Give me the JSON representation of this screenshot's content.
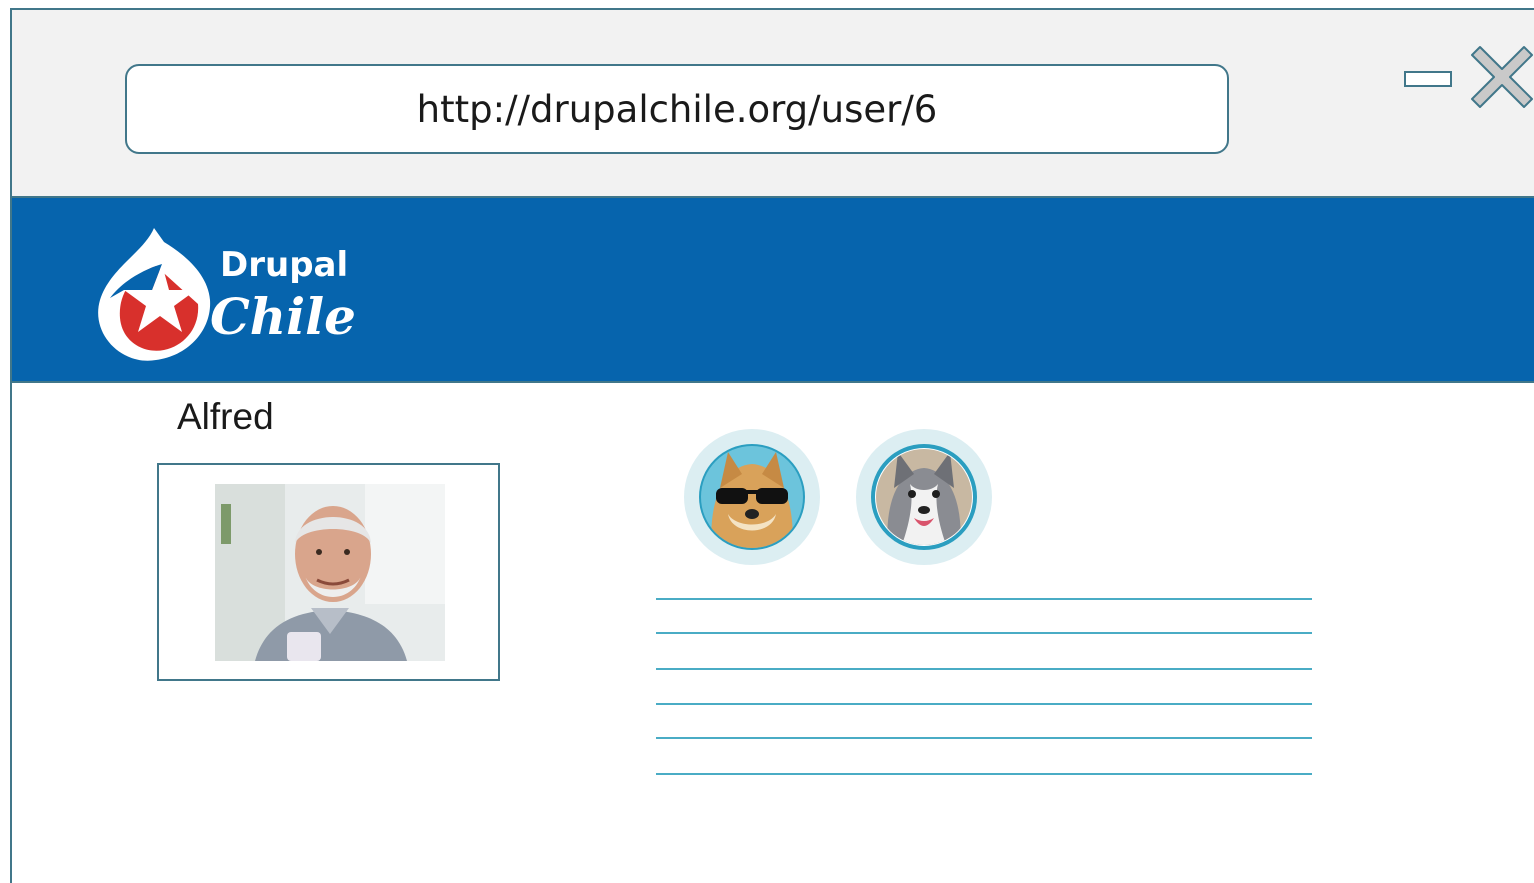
{
  "browser": {
    "url": "http://drupalchile.org/user/6",
    "minimize_icon": "minimize-icon",
    "close_icon": "close-icon"
  },
  "header": {
    "logo_line1": "Drupal",
    "logo_line2": "Chile",
    "brand_color": "#0664ad"
  },
  "profile": {
    "name": "Alfred",
    "photo_icon": "user-photo",
    "pets": [
      {
        "icon": "doge-sunglasses-avatar"
      },
      {
        "icon": "husky-avatar"
      }
    ],
    "text_lines": 6
  }
}
